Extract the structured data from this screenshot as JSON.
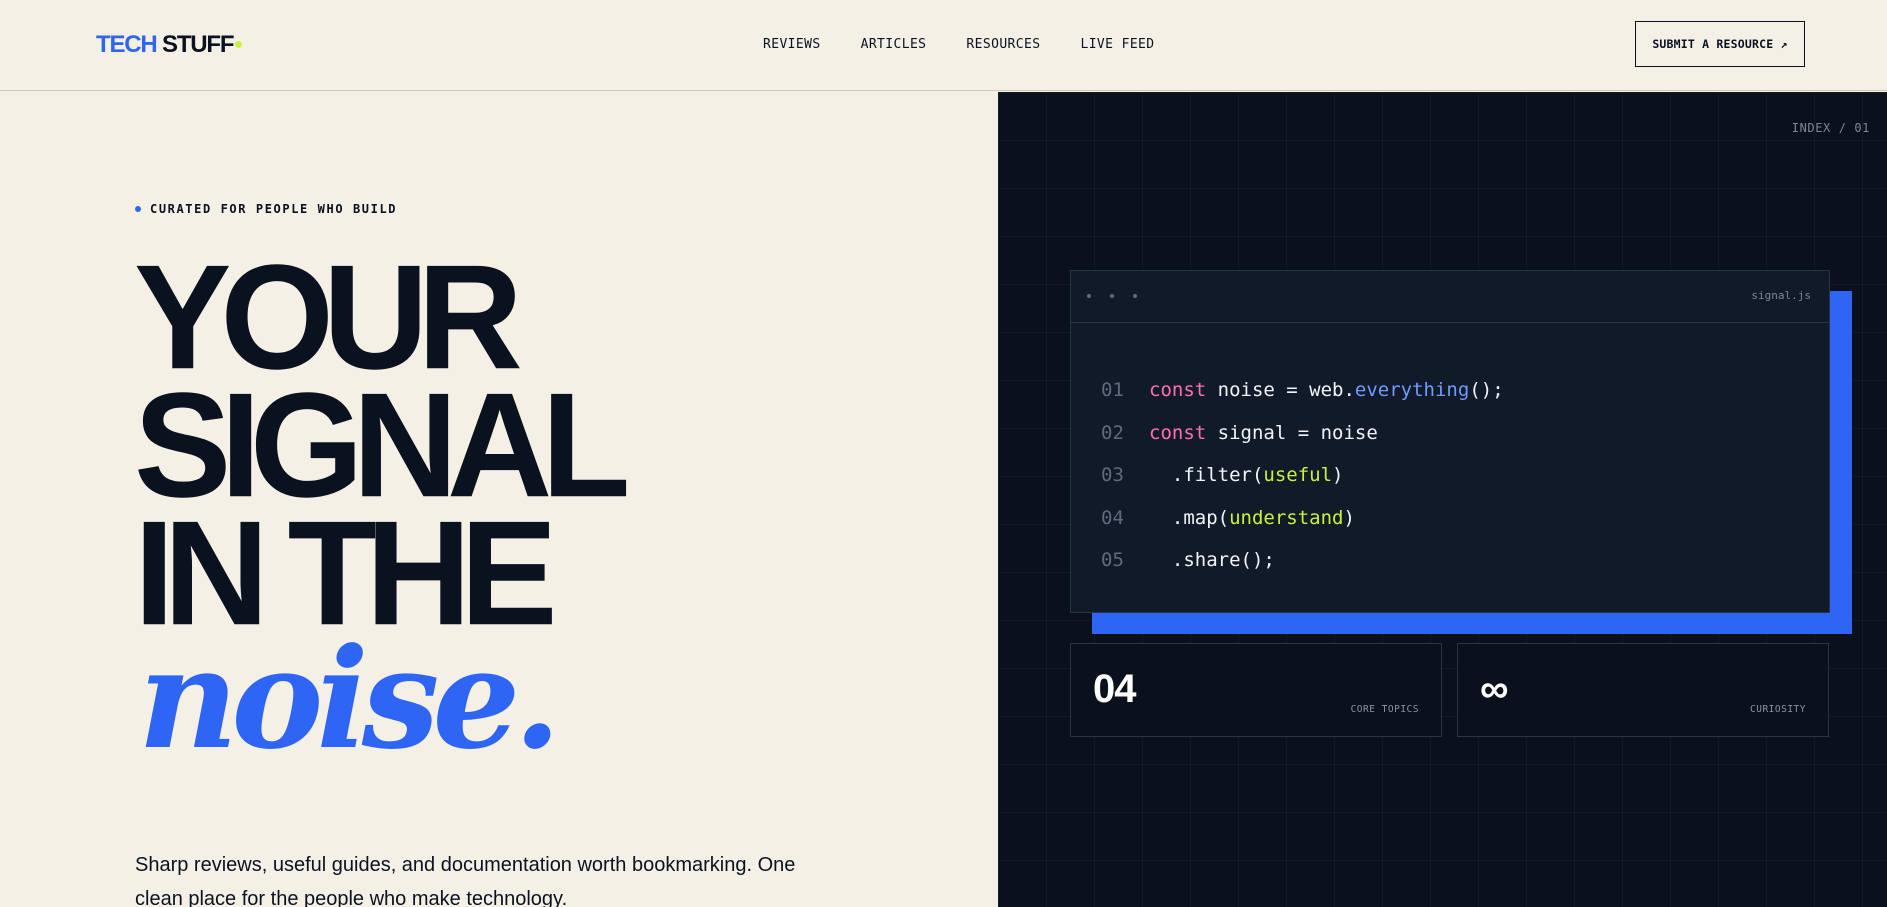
{
  "header": {
    "logo": {
      "part1": "TECH",
      "part2": "STUFF"
    },
    "nav": [
      "REVIEWS",
      "ARTICLES",
      "RESOURCES",
      "LIVE FEED"
    ],
    "cta_label": "SUBMIT A RESOURCE ↗"
  },
  "hero": {
    "eyebrow": "CURATED FOR PEOPLE WHO BUILD",
    "headline_lines": [
      "YOUR",
      "SIGNAL",
      "IN THE"
    ],
    "headline_accent": "noise.",
    "lede": "Sharp reviews, useful guides, and documentation worth bookmarking. One clean place for the people who make technology."
  },
  "panel": {
    "index_label": "INDEX / 01",
    "code_window": {
      "filename": "signal.js",
      "lines": [
        {
          "num": "01",
          "tokens": [
            {
              "t": "const",
              "c": "kw"
            },
            {
              "t": " noise = web.",
              "c": ""
            },
            {
              "t": "everything",
              "c": "fn"
            },
            {
              "t": "();",
              "c": ""
            }
          ]
        },
        {
          "num": "02",
          "tokens": [
            {
              "t": "const",
              "c": "kw"
            },
            {
              "t": " signal = noise",
              "c": ""
            }
          ]
        },
        {
          "num": "03",
          "tokens": [
            {
              "t": "  .filter(",
              "c": ""
            },
            {
              "t": "useful",
              "c": "arg"
            },
            {
              "t": ")",
              "c": ""
            }
          ]
        },
        {
          "num": "04",
          "tokens": [
            {
              "t": "  .map(",
              "c": ""
            },
            {
              "t": "understand",
              "c": "arg"
            },
            {
              "t": ")",
              "c": ""
            }
          ]
        },
        {
          "num": "05",
          "tokens": [
            {
              "t": "  .share();",
              "c": ""
            }
          ]
        }
      ]
    },
    "stats": [
      {
        "value": "04",
        "label": "CORE TOPICS"
      },
      {
        "value": "∞",
        "label": "CURIOSITY"
      }
    ]
  },
  "colors": {
    "accent_blue": "#2f65f5",
    "accent_lime": "#c8f23c",
    "keyword_pink": "#ff6fb5",
    "cream_bg": "#f5f0e6",
    "dark_bg": "#0a111d"
  }
}
